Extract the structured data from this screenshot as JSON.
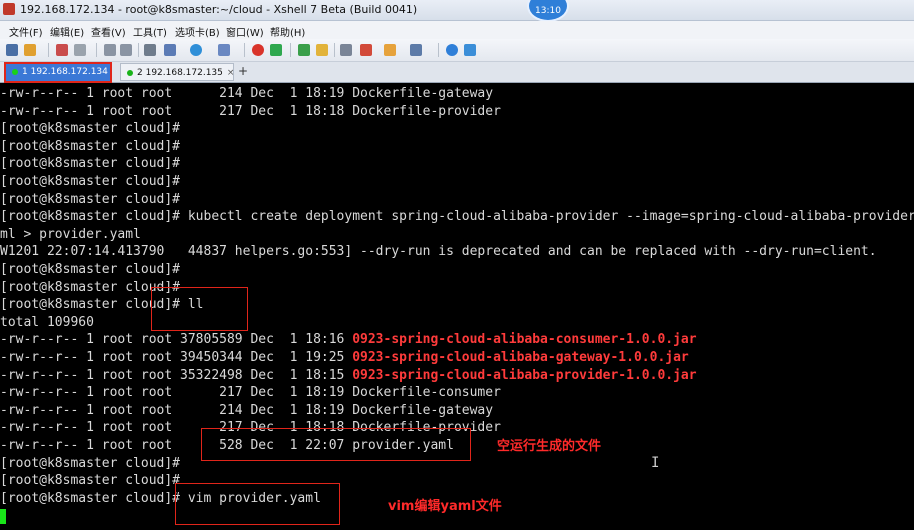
{
  "window": {
    "title": "192.168.172.134 - root@k8smaster:~/cloud - Xshell 7 Beta (Build 0041)",
    "clock": "13:10"
  },
  "menu": [
    "文件(F)",
    "编辑(E)",
    "查看(V)",
    "工具(T)",
    "选项卡(B)",
    "窗口(W)",
    "帮助(H)"
  ],
  "tabs": [
    {
      "label": "1 192.168.172.134",
      "active": true,
      "status_color": "#19d119"
    },
    {
      "label": "2 192.168.172.135",
      "active": false,
      "status_color": "#19b319"
    }
  ],
  "tab_add": "+",
  "terminal": {
    "lines": [
      "-rw-r--r-- 1 root root      214 Dec  1 18:19 Dockerfile-gateway",
      "-rw-r--r-- 1 root root      217 Dec  1 18:18 Dockerfile-provider",
      "[root@k8smaster cloud]#",
      "[root@k8smaster cloud]#",
      "[root@k8smaster cloud]#",
      "[root@k8smaster cloud]#",
      "[root@k8smaster cloud]#",
      "[root@k8smaster cloud]# kubectl create deployment spring-cloud-alibaba-provider --image=spring-cloud-alibaba-provider -",
      "ml > provider.yaml",
      "W1201 22:07:14.413790   44837 helpers.go:553] --dry-run is deprecated and can be replaced with --dry-run=client.",
      "[root@k8smaster cloud]#",
      "[root@k8smaster cloud]#",
      "[root@k8smaster cloud]# ll",
      "total 109960"
    ],
    "listing": [
      {
        "prefix": "-rw-r--r-- 1 root root 37805589 Dec  1 18:16 ",
        "name": "0923-spring-cloud-alibaba-consumer-1.0.0.jar",
        "jar": true
      },
      {
        "prefix": "-rw-r--r-- 1 root root 39450344 Dec  1 19:25 ",
        "name": "0923-spring-cloud-alibaba-gateway-1.0.0.jar",
        "jar": true
      },
      {
        "prefix": "-rw-r--r-- 1 root root 35322498 Dec  1 18:15 ",
        "name": "0923-spring-cloud-alibaba-provider-1.0.0.jar",
        "jar": true
      },
      {
        "prefix": "-rw-r--r-- 1 root root      217 Dec  1 18:19 ",
        "name": "Dockerfile-consumer",
        "jar": false
      },
      {
        "prefix": "-rw-r--r-- 1 root root      214 Dec  1 18:19 ",
        "name": "Dockerfile-gateway",
        "jar": false
      },
      {
        "prefix": "-rw-r--r-- 1 root root      217 Dec  1 18:18 ",
        "name": "Dockerfile-provider",
        "jar": false
      },
      {
        "prefix": "-rw-r--r-- 1 root root      528 Dec  1 22:07 ",
        "name": "provider.yaml",
        "jar": false
      }
    ],
    "tail": [
      "[root@k8smaster cloud]#",
      "[root@k8smaster cloud]#",
      "[root@k8smaster cloud]# vim provider.yaml"
    ],
    "colors": {
      "text": "#d9d9d9",
      "jar": "#ff3b3b",
      "annotation": "#ff2a2a",
      "cursor": "#19e619"
    }
  },
  "annotations": {
    "empty_run": "空运行生成的文件",
    "vim_edit": "vim编辑yaml文件"
  }
}
